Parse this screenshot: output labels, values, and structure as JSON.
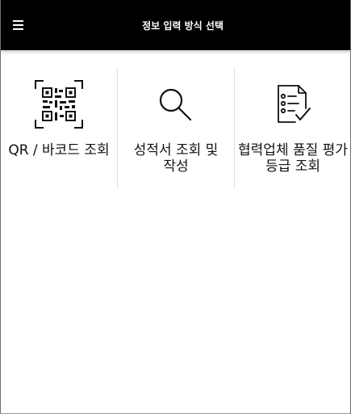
{
  "app_bar": {
    "title": "정보 입력 방식 선택",
    "menu_icon": "hamburger-menu-icon"
  },
  "options": [
    {
      "label": "QR / 바코드 조회",
      "icon": "qr-code-icon"
    },
    {
      "label": "성적서 조회 및 작성",
      "icon": "search-icon"
    },
    {
      "label": "협력업체 품질 평가\n등급 조회",
      "icon": "checklist-document-icon"
    }
  ],
  "colors": {
    "app_bar_background": "#000000",
    "app_bar_text": "#ffffff",
    "divider": "#cfe2f1",
    "icon_stroke": "#111111"
  }
}
